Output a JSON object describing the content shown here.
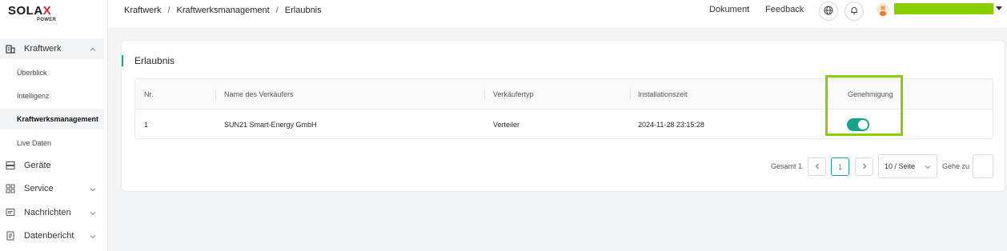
{
  "brand": {
    "logo_main_a": "SOLA",
    "logo_main_x": "X",
    "logo_sub": "POWER"
  },
  "sidebar": {
    "parent": {
      "label": "Kraftwerk",
      "icon": "building-icon"
    },
    "sub_items": [
      {
        "label": "Überblick"
      },
      {
        "label": "Intelligenz"
      },
      {
        "label": "Kraftwerksmanagement",
        "active": true
      },
      {
        "label": "Live Daten"
      }
    ],
    "items": [
      {
        "label": "Geräte",
        "icon": "server-icon"
      },
      {
        "label": "Service",
        "icon": "grid-icon"
      },
      {
        "label": "Nachrichten",
        "icon": "message-icon"
      },
      {
        "label": "Datenbericht",
        "icon": "report-icon"
      }
    ]
  },
  "header": {
    "breadcrumb": [
      "Kraftwerk",
      "Kraftwerksmanagement",
      "Erlaubnis"
    ],
    "separator": "/",
    "links": {
      "document": "Dokument",
      "feedback": "Feedback"
    }
  },
  "page": {
    "title": "Erlaubnis",
    "table": {
      "columns": [
        "Nr.",
        "Name des Verkäufers",
        "Verkäufertyp",
        "Installationszeit",
        "Genehmigung"
      ],
      "rows": [
        {
          "nr": "1",
          "name": "SUN21 Smart-Energy GmbH",
          "type": "Verteiler",
          "time": "2024-11-28 23:15:28",
          "approved": true
        }
      ]
    },
    "pagination": {
      "total": "Gesamt 1",
      "prev": "‹",
      "next": "›",
      "current_page": "1",
      "page_size": "10 / Seite",
      "goto_label": "Gehe zu"
    }
  },
  "colors": {
    "accent": "#17a589",
    "highlight": "#8ad000",
    "brand_red": "#e8212a"
  }
}
